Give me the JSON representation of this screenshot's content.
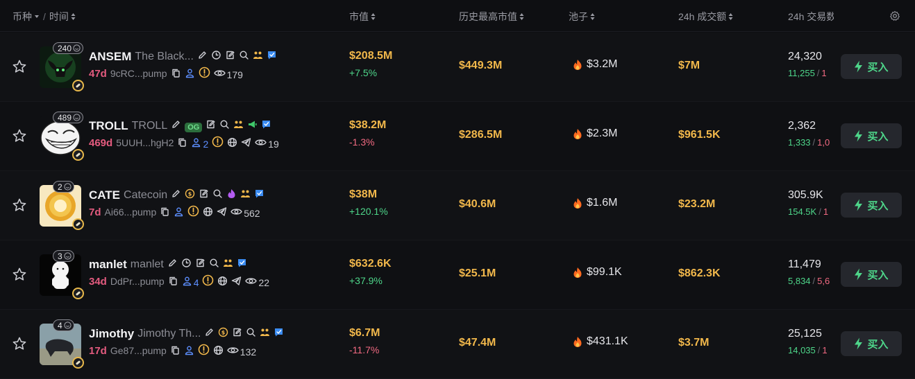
{
  "header": {
    "col_coin": "币种",
    "col_time": "时间",
    "col_mcap": "市值",
    "col_ath": "历史最高市值",
    "col_pool": "池子",
    "col_vol": "24h 成交额",
    "col_txns": "24h 交易数"
  },
  "rows": [
    {
      "symbol": "ANSEM",
      "name": "The Black...",
      "holders_badge": "240",
      "age": "47d",
      "address": "9cRC...pump",
      "holders": "",
      "views": "179",
      "mcap": "$208.5M",
      "change": "+7.5%",
      "ath": "$449.3M",
      "pool": "$3.2M",
      "vol": "$7M",
      "txns": "24,320",
      "buys": "11,255",
      "sells": "1",
      "buy_label": "买入"
    },
    {
      "symbol": "TROLL",
      "name": "TROLL",
      "og": "OG",
      "holders_badge": "489",
      "age": "469d",
      "address": "5UUH...hgH2",
      "holders": "2",
      "views": "19",
      "mcap": "$38.2M",
      "change": "-1.3%",
      "ath": "$286.5M",
      "pool": "$2.3M",
      "vol": "$961.5K",
      "txns": "2,362",
      "buys": "1,333",
      "sells": "1,0",
      "buy_label": "买入"
    },
    {
      "symbol": "CATE",
      "name": "Catecoin",
      "holders_badge": "2",
      "age": "7d",
      "address": "Ai66...pump",
      "holders": "",
      "views": "562",
      "mcap": "$38M",
      "change": "+120.1%",
      "ath": "$40.6M",
      "pool": "$1.6M",
      "vol": "$23.2M",
      "txns": "305.9K",
      "buys": "154.5K",
      "sells": "1",
      "buy_label": "买入"
    },
    {
      "symbol": "manlet",
      "name": "manlet",
      "holders_badge": "3",
      "age": "34d",
      "address": "DdPr...pump",
      "holders": "4",
      "views": "22",
      "mcap": "$632.6K",
      "change": "+37.9%",
      "ath": "$25.1M",
      "pool": "$99.1K",
      "vol": "$862.3K",
      "txns": "11,479",
      "buys": "5,834",
      "sells": "5,6",
      "buy_label": "买入"
    },
    {
      "symbol": "Jimothy",
      "name": "Jimothy Th...",
      "holders_badge": "4",
      "age": "17d",
      "address": "Ge87...pump",
      "holders": "",
      "views": "132",
      "mcap": "$6.7M",
      "change": "-11.7%",
      "ath": "$47.4M",
      "pool": "$431.1K",
      "vol": "$3.7M",
      "txns": "25,125",
      "buys": "14,035",
      "sells": "1",
      "buy_label": "买入"
    }
  ],
  "colors": {
    "accent_gold": "#f2b84b",
    "positive": "#4ed68a",
    "negative": "#f26a82",
    "age": "#e45b7f",
    "link_blue": "#5d8fff"
  }
}
